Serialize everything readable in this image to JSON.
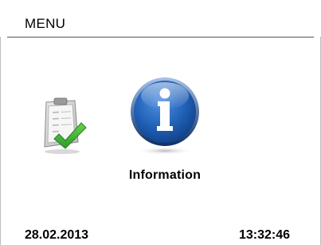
{
  "header": {
    "title": "MENU"
  },
  "menu": {
    "items": [
      {
        "icon": "checklist-icon"
      },
      {
        "icon": "info-icon",
        "label": "Information"
      }
    ]
  },
  "status": {
    "date": "28.02.2013",
    "time": "13:32:46"
  },
  "colors": {
    "info_blue": "#1f5fb5",
    "check_green": "#3aaa35",
    "rule": "#555555"
  }
}
